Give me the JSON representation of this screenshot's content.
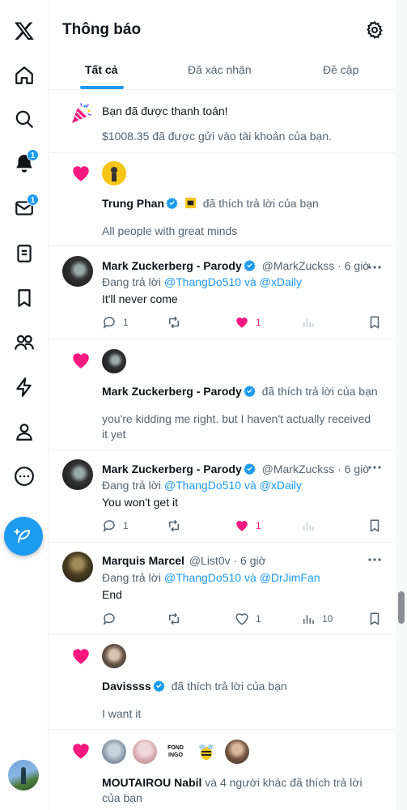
{
  "nav": {
    "badges": {
      "notifications": "1",
      "messages": "1"
    }
  },
  "header": {
    "title": "Thông báo",
    "tabs": [
      "Tất cả",
      "Đã xác nhận",
      "Đề cập"
    ]
  },
  "payment": {
    "title": "Bạn đã được thanh toán!",
    "detail": "$1008.35 đã được gửi vào tài khoản của bạn."
  },
  "like1": {
    "name": "Trung Phan",
    "action": "đã thích trả lời của bạn",
    "text": "All people with great minds"
  },
  "reply1": {
    "name": "Mark Zuckerberg - Parody",
    "handle_time": "@MarkZuckss · 6 giờ",
    "replying_prefix": "Đang trả lời",
    "mention1": "@ThangDo510",
    "and": "và",
    "mention2": "@xDaily",
    "text": "It'll never come",
    "reply_count": "1",
    "like_count": "1"
  },
  "like2": {
    "name": "Mark Zuckerberg - Parody",
    "action": "đã thích trả lời của bạn",
    "text_line1": "you're kidding me right. but I haven't actually received",
    "text_line2": "it yet"
  },
  "reply2": {
    "name": "Mark Zuckerberg - Parody",
    "handle_time": "@MarkZuckss · 6 giờ",
    "replying_prefix": "Đang trả lời",
    "mention1": "@ThangDo510",
    "and": "và",
    "mention2": "@xDaily",
    "text": "You won't get it",
    "reply_count": "1",
    "like_count": "1"
  },
  "reply3": {
    "name": "Marquis Marcel",
    "handle_time": "@List0v · 6 giờ",
    "replying_prefix": "Đang trả lời",
    "mention1": "@ThangDo510",
    "and": "và",
    "mention2": "@DrJimFan",
    "text": "End",
    "like_count": "1",
    "view_count": "10"
  },
  "like3": {
    "name": "Davissss",
    "action": "đã thích trả lời của bạn",
    "text": "I want it"
  },
  "like4": {
    "name": "MOUTAIROU Nabil",
    "action_line1": "và 4 người khác đã thích trả lời",
    "action_line2": "của bạn",
    "avatar_text": "FOND INGO"
  },
  "colors": {
    "accent": "#1d9bf0",
    "like": "#f91880",
    "text": "#0f1419",
    "muted": "#536471"
  }
}
